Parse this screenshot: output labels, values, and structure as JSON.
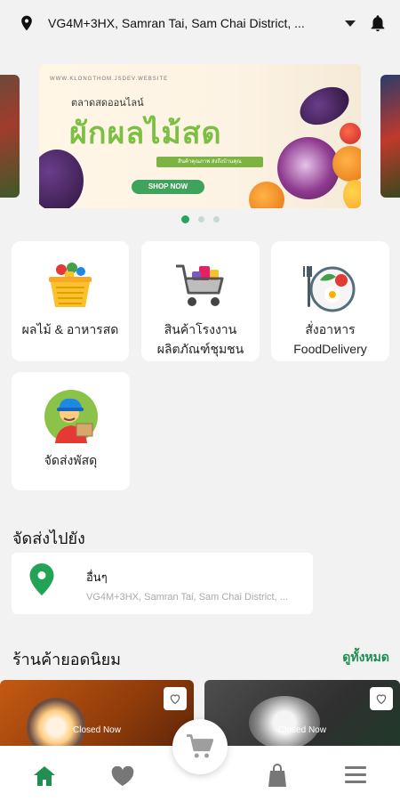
{
  "header": {
    "location": "VG4M+3HX, Samran Tai, Sam Chai District, ...",
    "icons": [
      "location-pin-icon",
      "chevron-down-icon",
      "bell-icon"
    ]
  },
  "banner": {
    "site": "WWW.KLONGTHOM.JSDEV.WEBSITE",
    "subtitle": "ตลาดสดออนไลน์",
    "title": "ผักผลไม้สด",
    "tagline": "สินค้าคุณภาพ ส่งถึงบ้านคุณ",
    "cta": "SHOP NOW",
    "pagination": {
      "count": 3,
      "active": 0
    }
  },
  "categories": [
    {
      "label": "ผลไม้ & อาหารสด",
      "icon": "basket-icon"
    },
    {
      "label": "สินค้าโรงงาน\nผลิตภัณฑ์ชุมชน",
      "icon": "shopping-cart-icon"
    },
    {
      "label": "สั่งอาหาร\nFoodDelivery",
      "icon": "food-plate-icon"
    },
    {
      "label": "จัดส่งพัสดุ",
      "icon": "delivery-man-icon"
    }
  ],
  "shipping": {
    "title": "จัดส่งไปยัง",
    "name": "อื่นๆ",
    "address": "VG4M+3HX, Samran Tai, Sam Chai District, ..."
  },
  "popular": {
    "title": "ร้านค้ายอดนิยม",
    "see_all": "ดูทั้งหมด",
    "stores": [
      {
        "status": "Closed Now"
      },
      {
        "status": "Closed Now"
      }
    ]
  },
  "bottom_nav": {
    "items": [
      "home-icon",
      "heart-icon",
      "cart-icon",
      "bag-icon",
      "menu-icon"
    ],
    "active": "home-icon"
  },
  "colors": {
    "accent": "#1e8f4e",
    "background": "#f2f2f2",
    "card": "#ffffff"
  }
}
